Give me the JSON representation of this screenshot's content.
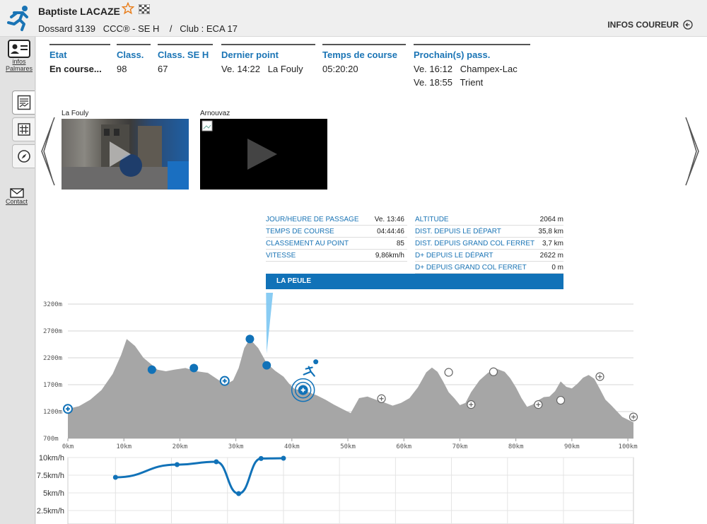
{
  "header": {
    "runner_name": "Baptiste LACAZE",
    "bib_line": "Dossard 3139   CCC® - SE H    /   Club : ECA 17",
    "infos_button": "INFOS COUREUR"
  },
  "sidebar": {
    "infos_label": "infos",
    "palmares_label": "Palmares",
    "contact_label": "Contact"
  },
  "stats": {
    "etat": {
      "label": "Etat",
      "value": "En course..."
    },
    "class": {
      "label": "Class.",
      "value": "98"
    },
    "class_cat": {
      "label": "Class. SE H",
      "value": "67"
    },
    "dernier": {
      "label": "Dernier point",
      "value": "Ve. 14:22   La Fouly"
    },
    "temps": {
      "label": "Temps de course",
      "value": "05:20:20"
    },
    "prochain": {
      "label": "Prochain(s) pass.",
      "line1": "Ve. 16:12   Champex-Lac",
      "line2": "Ve. 18:55   Trient"
    }
  },
  "videos": [
    {
      "title": "La Fouly"
    },
    {
      "title": "Arnouvaz"
    }
  ],
  "tooltip": {
    "left": [
      {
        "k": "JOUR/HEURE DE PASSAGE",
        "v": "Ve. 13:46"
      },
      {
        "k": "TEMPS DE COURSE",
        "v": "04:44:46"
      },
      {
        "k": "CLASSEMENT AU POINT",
        "v": "85"
      },
      {
        "k": "VITESSE",
        "v": "9,86km/h"
      }
    ],
    "right": [
      {
        "k": "ALTITUDE",
        "v": "2064 m"
      },
      {
        "k": "DIST. DEPUIS LE DÉPART",
        "v": "35,8 km"
      },
      {
        "k": "DIST. DEPUIS GRAND COL FERRET",
        "v": "3,7 km"
      },
      {
        "k": "D+ DEPUIS LE DÉPART",
        "v": "2622 m"
      },
      {
        "k": "D+ DEPUIS GRAND COL FERRET",
        "v": "0 m"
      }
    ],
    "point_name": "LA PEULE"
  },
  "chart_data": [
    {
      "type": "area",
      "title": "",
      "xlabel": "",
      "ylabel": "",
      "xlim": [
        0,
        101
      ],
      "ylim": [
        700,
        3200
      ],
      "x_ticks": [
        "0km",
        "10km",
        "20km",
        "30km",
        "40km",
        "50km",
        "60km",
        "70km",
        "80km",
        "90km",
        "100km"
      ],
      "y_ticks": [
        "700m",
        "1200m",
        "1700m",
        "2200m",
        "2700m",
        "3200m"
      ],
      "grid": true,
      "colors": {
        "fill": "#a6a6a6",
        "passed": "#1172b8"
      },
      "x": [
        0,
        2,
        4,
        6,
        8,
        9.5,
        10.5,
        12,
        13.5,
        15,
        16,
        17.5,
        19,
        21,
        23,
        25,
        27,
        28.5,
        29.5,
        30.5,
        31.5,
        32.5,
        34,
        35.5,
        37,
        38.5,
        39.5,
        40.5,
        41.5,
        43,
        44.5,
        46,
        47.5,
        49,
        50.5,
        52,
        53.5,
        55,
        56.5,
        58,
        59.5,
        61,
        62.5,
        64,
        65,
        66,
        67,
        68,
        69,
        70,
        71,
        72,
        73.5,
        75,
        76.5,
        78,
        79,
        80,
        81,
        82,
        83,
        84,
        85,
        86,
        87,
        88,
        89,
        90,
        91,
        92,
        93,
        94,
        95,
        96,
        97,
        98,
        99,
        101
      ],
      "y": [
        1250,
        1300,
        1420,
        1600,
        1900,
        2250,
        2550,
        2420,
        2200,
        2070,
        1980,
        1950,
        1980,
        2010,
        1950,
        1920,
        1780,
        1720,
        1780,
        2010,
        2380,
        2550,
        2380,
        2100,
        1960,
        1850,
        1720,
        1620,
        1600,
        1560,
        1500,
        1420,
        1330,
        1250,
        1170,
        1450,
        1480,
        1420,
        1370,
        1310,
        1360,
        1450,
        1650,
        1930,
        2020,
        1940,
        1760,
        1560,
        1450,
        1320,
        1360,
        1560,
        1780,
        1920,
        2000,
        1940,
        1820,
        1650,
        1450,
        1290,
        1330,
        1410,
        1470,
        1480,
        1580,
        1760,
        1660,
        1630,
        1720,
        1830,
        1880,
        1810,
        1620,
        1420,
        1320,
        1210,
        1100,
        1000
      ],
      "checkpoints_passed": [
        [
          0,
          1250
        ],
        [
          15,
          1980
        ],
        [
          22.5,
          2010
        ],
        [
          28,
          1770
        ],
        [
          32.5,
          2550
        ],
        [
          35.5,
          2060
        ],
        [
          42,
          1600
        ]
      ],
      "checkpoints_future": [
        [
          56,
          1440
        ],
        [
          68,
          1930
        ],
        [
          72,
          1330
        ],
        [
          76,
          1940
        ],
        [
          84,
          1330
        ],
        [
          88,
          1410
        ],
        [
          95,
          1850
        ],
        [
          101,
          1100
        ]
      ]
    },
    {
      "type": "line",
      "title": "",
      "xlabel": "",
      "ylabel": "",
      "xlim": [
        0,
        101
      ],
      "ylim": [
        0,
        10
      ],
      "y_ticks": [
        "2.5km/h",
        "5km/h",
        "7.5km/h",
        "10km/h"
      ],
      "grid": true,
      "colors": {
        "line": "#1172b8"
      },
      "x": [
        8.5,
        19.5,
        26.5,
        30.5,
        34.5,
        38.5
      ],
      "y": [
        7.2,
        9.0,
        9.4,
        4.9,
        9.86,
        9.9
      ]
    }
  ]
}
